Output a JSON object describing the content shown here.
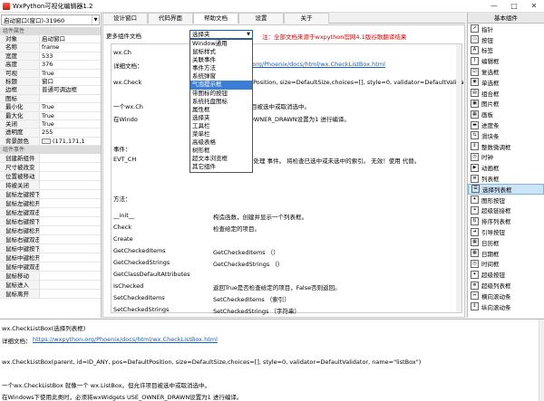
{
  "window": {
    "title": "WxPython可视化编辑器1.2",
    "minimize": "—",
    "maximize": "□",
    "close": "✕"
  },
  "left": {
    "combo_value": "启动窗口(窗口)-31960",
    "section_props": "组件属性",
    "props": [
      {
        "k": "对象",
        "v": "启动窗口"
      },
      {
        "k": "名称",
        "v": "frame"
      },
      {
        "k": "宽度",
        "v": "533"
      },
      {
        "k": "高度",
        "v": "376"
      },
      {
        "k": "可视",
        "v": "True"
      },
      {
        "k": "标题",
        "v": "窗口"
      },
      {
        "k": "边框",
        "v": "普通可调边框"
      },
      {
        "k": "图标",
        "v": ""
      },
      {
        "k": "最小化",
        "v": "True"
      },
      {
        "k": "最大化",
        "v": "True"
      },
      {
        "k": "关闭",
        "v": "True"
      },
      {
        "k": "透明度",
        "v": "255"
      },
      {
        "k": "背景颜色",
        "v": "(171,171,1"
      }
    ],
    "section_events": "组件事件",
    "events": [
      "创建新组件",
      "尺寸被改变",
      "位置被移动",
      "将被关闭",
      "鼠标左键按下",
      "鼠标左键松开",
      "鼠标左键双击",
      "鼠标右键按下",
      "鼠标右键松开",
      "鼠标右键双击",
      "鼠标中键按下",
      "鼠标中键松开",
      "鼠标中键双击",
      "鼠标移动",
      "鼠标进入",
      "鼠标离开"
    ]
  },
  "tabs": [
    "设计窗口",
    "代码界面",
    "帮助文档",
    "设置",
    "关于"
  ],
  "help": {
    "more_label": "更多组件文档",
    "dropdown_value": "选择夹",
    "note": "注：全部文档来源于wxpython官网4.1版谷歌翻译结果",
    "options": [
      "Window通用",
      "鼠标样式",
      "关联事件",
      "事件方法",
      "系统弹窗",
      "气泡提示框",
      "带图标的按钮",
      "系统托盘图标",
      "属性框",
      "选择夹",
      "工具栏",
      "菜单栏",
      "高级表格",
      "树形框",
      "超文本浏览框",
      "其它组件"
    ],
    "selected_index": 5,
    "doc": {
      "l1": "wx.Ch",
      "l2a": "详细文档：",
      "l2b": "https://wxpython.org/Phoenix/docs/html/wx.CheckListBox.html",
      "l3a": "wx.Check",
      "l3b": "ANY, pos=DefaultPosition, size=DefaultSize,choices=[], style=0, validator=DefaultValidator, na",
      "l4a": "一个wx.Ch",
      "l4b": "ListBox。但允许项目被选中或取消选中。",
      "l5a": "在Windo",
      "l5b": "wxWidgets USE_OWNER_DRAWN设置为1 进行编译。",
      "l6": "事件：",
      "l7a": "EVT_CH",
      "l7b": "框或未选中复选框时处理 事件。 将检查已选中或未选中的索引。 无效！使用 代替。",
      "methods_title": "方法：",
      "methods": [
        [
          "__init__",
          "构造函数，创建并显示一个列表框。"
        ],
        [
          "Check",
          "检查给定的项目。"
        ],
        [
          "Create",
          ""
        ],
        [
          "GetCheckedItems",
          "GetCheckedItems （）"
        ],
        [
          "GetCheckedStrings",
          "GetCheckedStrings （）"
        ],
        [
          "GetClassDefaultAttributes",
          ""
        ],
        [
          "IsChecked",
          "返回True是否检查给定的项目，False否则返回。"
        ],
        [
          "SetCheckedItems",
          "SetCheckedItems （索引）"
        ],
        [
          "SetCheckedStrings",
          "SetCheckedStrings （字符串）"
        ]
      ]
    }
  },
  "right": {
    "tab": "基本组件",
    "items": [
      "指针",
      "按钮",
      "标签",
      "编辑框",
      "复选框",
      "单选框",
      "组合框",
      "图片框",
      "画板",
      "进度条",
      "滑块条",
      "整数微调框",
      "时钟",
      "动画框",
      "列表框",
      "选择列表框",
      "图形按钮",
      "超级链接框",
      "排序列表框",
      "引导按钮",
      "日历框",
      "日期框",
      "时间框",
      "超级按钮",
      "超级列表框",
      "横向滚动条",
      "纵向滚动条"
    ],
    "selected_index": 15
  },
  "bottom": {
    "title": "wx.CheckListBox(选择列表框)",
    "detail_label": "详细文档：",
    "detail_link": "https://wxpython.org/Phoenix/docs/html/wx.CheckListBox.html",
    "sig": "wx.CheckListBox(parent, id=ID_ANY, pos=DefaultPosition, size=DefaultSize,choices=[], style=0, validator=DefaultValidator, name=\"listBox\")",
    "desc1": "一个wx.CheckListBox 就像一个 wx.ListBox。但允许项目被选中或取消选中。",
    "desc2": "在Windows下使用此类时，必须将wxWidgets USE_OWNER_DRAWN设置为1 进行编译。"
  }
}
